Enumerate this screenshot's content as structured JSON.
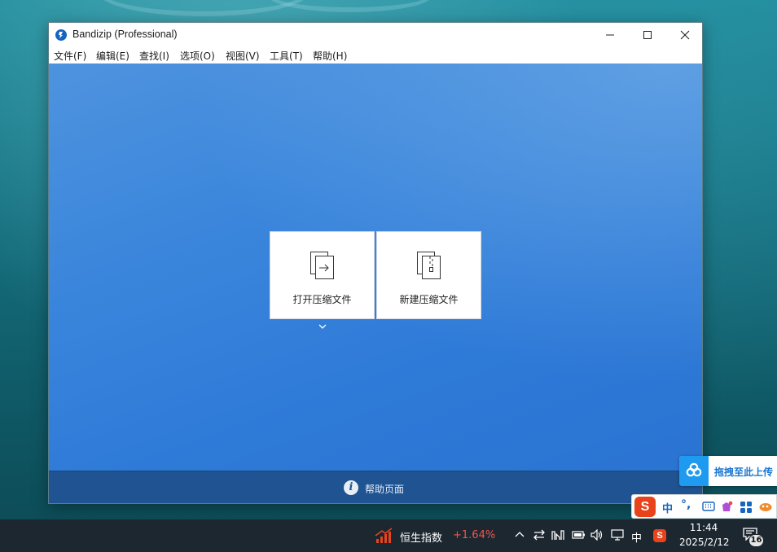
{
  "window": {
    "title": "Bandizip (Professional)",
    "controls": {
      "minimize": "minimize-icon",
      "maximize": "maximize-icon",
      "close": "close-icon"
    }
  },
  "menu": {
    "items": [
      "文件(F)",
      "编辑(E)",
      "查找(I)",
      "选项(O)",
      "视图(V)",
      "工具(T)",
      "帮助(H)"
    ]
  },
  "main": {
    "open_archive": {
      "label": "打开压缩文件",
      "icon": "open-archive-icon"
    },
    "new_archive": {
      "label": "新建压缩文件",
      "icon": "new-archive-icon"
    },
    "dropdown_icon": "chevron-down-icon"
  },
  "helpbar": {
    "label": "帮助页面",
    "icon": "info-icon"
  },
  "upload_widget": {
    "label": "拖拽至此上传",
    "icon": "baidu-cloud-icon"
  },
  "ime": {
    "logo": "S",
    "mode": "中",
    "punct": "°,"
  },
  "taskbar": {
    "stock_name": "恒生指数",
    "stock_change": "+1.64%",
    "ime_label": "中",
    "sogou": "S",
    "time": "11:44",
    "date": "2025/2/12",
    "notification_count": "16"
  },
  "colors": {
    "accent": "#2f7bd8",
    "helpbar": "#1f5391",
    "stock_up": "#f0544f",
    "taskbar": "#1d2730"
  }
}
